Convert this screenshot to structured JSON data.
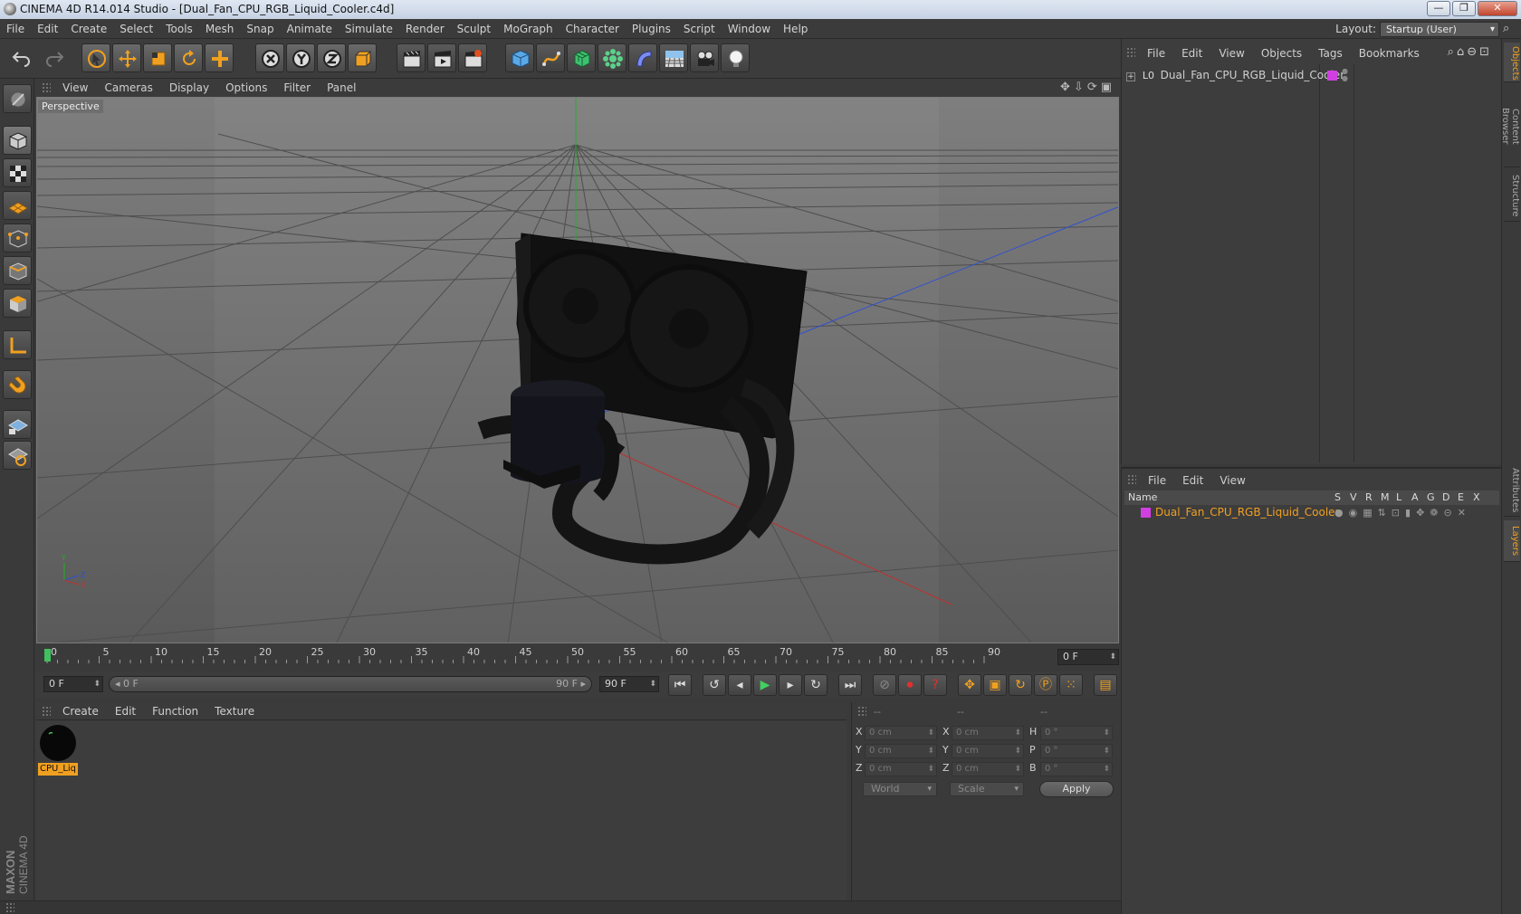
{
  "window": {
    "title": "CINEMA 4D R14.014 Studio - [Dual_Fan_CPU_RGB_Liquid_Cooler.c4d]",
    "minimize": "—",
    "maximize": "❐",
    "close": "✕"
  },
  "menubar": {
    "items": [
      "File",
      "Edit",
      "Create",
      "Select",
      "Tools",
      "Mesh",
      "Snap",
      "Animate",
      "Simulate",
      "Render",
      "Sculpt",
      "MoGraph",
      "Character",
      "Plugins",
      "Script",
      "Window",
      "Help"
    ],
    "layout_label": "Layout:",
    "layout_value": "Startup (User)"
  },
  "viewport": {
    "menu": [
      "View",
      "Cameras",
      "Display",
      "Options",
      "Filter",
      "Panel"
    ],
    "camera_label": "Perspective",
    "axis": {
      "y": "Y",
      "z": "Z",
      "x": "X"
    }
  },
  "timeline": {
    "ticks": [
      "0",
      "5",
      "10",
      "15",
      "20",
      "25",
      "30",
      "35",
      "40",
      "45",
      "50",
      "55",
      "60",
      "65",
      "70",
      "75",
      "80",
      "85",
      "90"
    ],
    "current_frame_display": "0 F"
  },
  "transport": {
    "start_frame": "0 F",
    "range_start": "0 F",
    "range_end": "90 F",
    "end_frame": "90 F"
  },
  "material_manager": {
    "menu": [
      "Create",
      "Edit",
      "Function",
      "Texture"
    ],
    "materials": [
      {
        "name": "CPU_Liq"
      }
    ]
  },
  "coordinates": {
    "headers": [
      "--",
      "--",
      "--"
    ],
    "rows": [
      {
        "label1": "X",
        "val1": "0 cm",
        "label2": "X",
        "val2": "0 cm",
        "label3": "H",
        "val3": "0 °"
      },
      {
        "label1": "Y",
        "val1": "0 cm",
        "label2": "Y",
        "val2": "0 cm",
        "label3": "P",
        "val3": "0 °"
      },
      {
        "label1": "Z",
        "val1": "0 cm",
        "label2": "Z",
        "val2": "0 cm",
        "label3": "B",
        "val3": "0 °"
      }
    ],
    "space": "World",
    "mode": "Scale",
    "apply": "Apply"
  },
  "object_manager": {
    "menu": [
      "File",
      "Edit",
      "View",
      "Objects",
      "Tags",
      "Bookmarks"
    ],
    "objects": [
      {
        "name": "Dual_Fan_CPU_RGB_Liquid_Cooler"
      }
    ]
  },
  "layer_manager": {
    "menu": [
      "File",
      "Edit",
      "View"
    ],
    "columns": [
      "Name",
      "S",
      "V",
      "R",
      "M",
      "L",
      "A",
      "G",
      "D",
      "E",
      "X"
    ],
    "layers": [
      {
        "name": "Dual_Fan_CPU_RGB_Liquid_Cooler",
        "color": "#d040e0"
      }
    ]
  },
  "side_tabs": [
    "Objects",
    "Content Browser",
    "Structure",
    "Attributes",
    "Layers"
  ],
  "brand": {
    "line1": "MAXON",
    "line2": "CINEMA 4D"
  },
  "colors": {
    "accent": "#f0a020",
    "layer": "#d040e0",
    "x_axis": "#c03030",
    "y_axis": "#20b020",
    "z_axis": "#3050d0"
  }
}
